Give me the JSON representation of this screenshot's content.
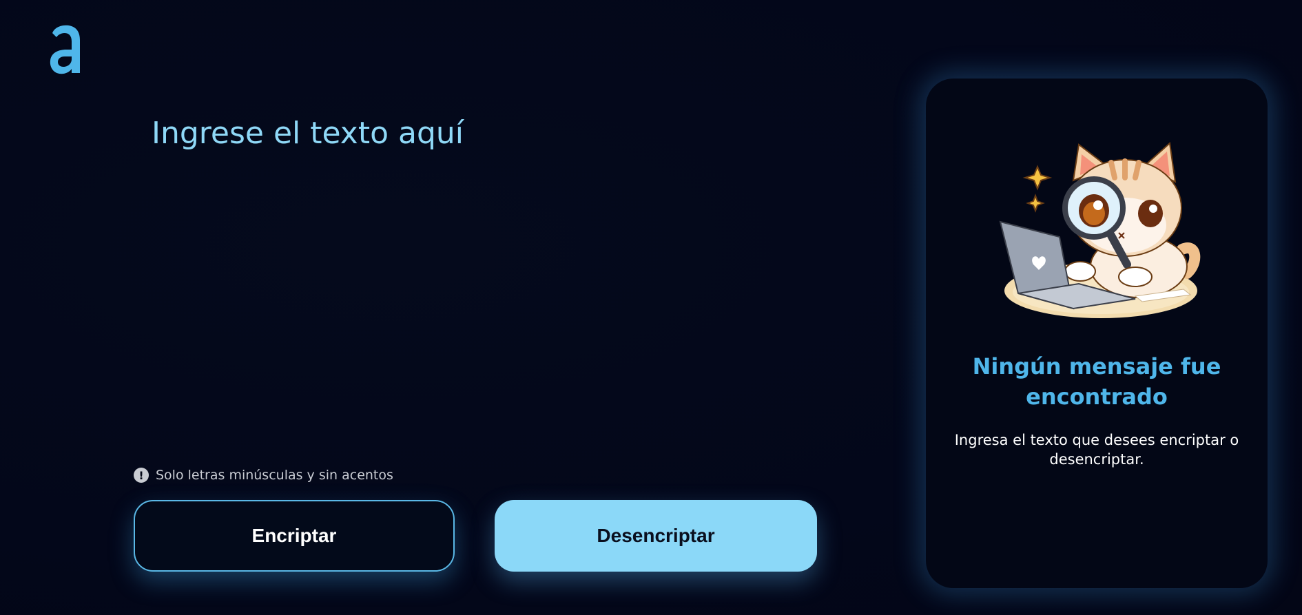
{
  "app": {
    "logo_icon": "letter-a-logo-icon",
    "accent_color": "#4fb6ea"
  },
  "input": {
    "placeholder": "Ingrese el texto aquí",
    "value": ""
  },
  "hint": {
    "icon": "exclamation-circle-icon",
    "text": "Solo letras minúsculas y sin acentos"
  },
  "actions": {
    "encrypt_label": "Encriptar",
    "decrypt_label": "Desencriptar"
  },
  "result_panel": {
    "illustration": "cat-with-magnifying-glass-and-laptop",
    "title": "Ningún mensaje fue encontrado",
    "text": "Ingresa el texto que desees encriptar o desencriptar."
  }
}
